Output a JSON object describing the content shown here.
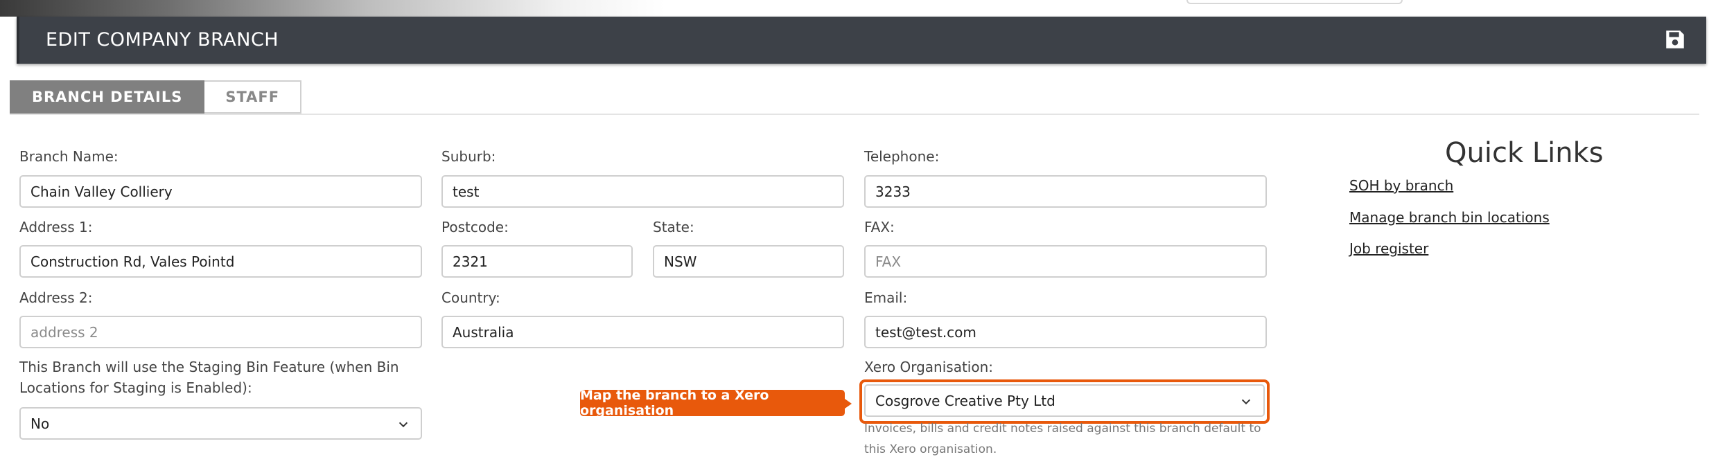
{
  "header": {
    "title": "EDIT COMPANY BRANCH",
    "save_icon": "save-icon"
  },
  "tabs": [
    {
      "label": "BRANCH DETAILS",
      "active": true
    },
    {
      "label": "STAFF",
      "active": false
    }
  ],
  "form": {
    "branch_name": {
      "label": "Branch Name:",
      "value": "Chain Valley Colliery"
    },
    "address1": {
      "label": "Address 1:",
      "value": "Construction Rd, Vales Pointd"
    },
    "address2": {
      "label": "Address 2:",
      "value": "",
      "placeholder": "address 2"
    },
    "staging": {
      "label": "This Branch will use the Staging Bin Feature (when Bin Locations for Staging is Enabled):",
      "value": "No"
    },
    "suburb": {
      "label": "Suburb:",
      "value": "test"
    },
    "postcode": {
      "label": "Postcode:",
      "value": "2321"
    },
    "state": {
      "label": "State:",
      "value": "NSW"
    },
    "country": {
      "label": "Country:",
      "value": "Australia"
    },
    "telephone": {
      "label": "Telephone:",
      "value": "3233"
    },
    "fax": {
      "label": "FAX:",
      "value": "",
      "placeholder": "FAX"
    },
    "email": {
      "label": "Email:",
      "value": "test@test.com"
    },
    "xero": {
      "label": "Xero Organisation:",
      "value": "Cosgrove Creative Pty Ltd",
      "help": "Invoices, bills and credit notes raised against this branch default to this Xero organisation.",
      "tooltip": "Map the branch to a Xero organisation"
    }
  },
  "quick_links": {
    "title": "Quick Links",
    "items": [
      "SOH by branch",
      "Manage branch bin locations",
      "Job register"
    ]
  },
  "colors": {
    "header_bg": "#3d4148",
    "accent": "#e8590c",
    "tab_active": "#808080"
  }
}
